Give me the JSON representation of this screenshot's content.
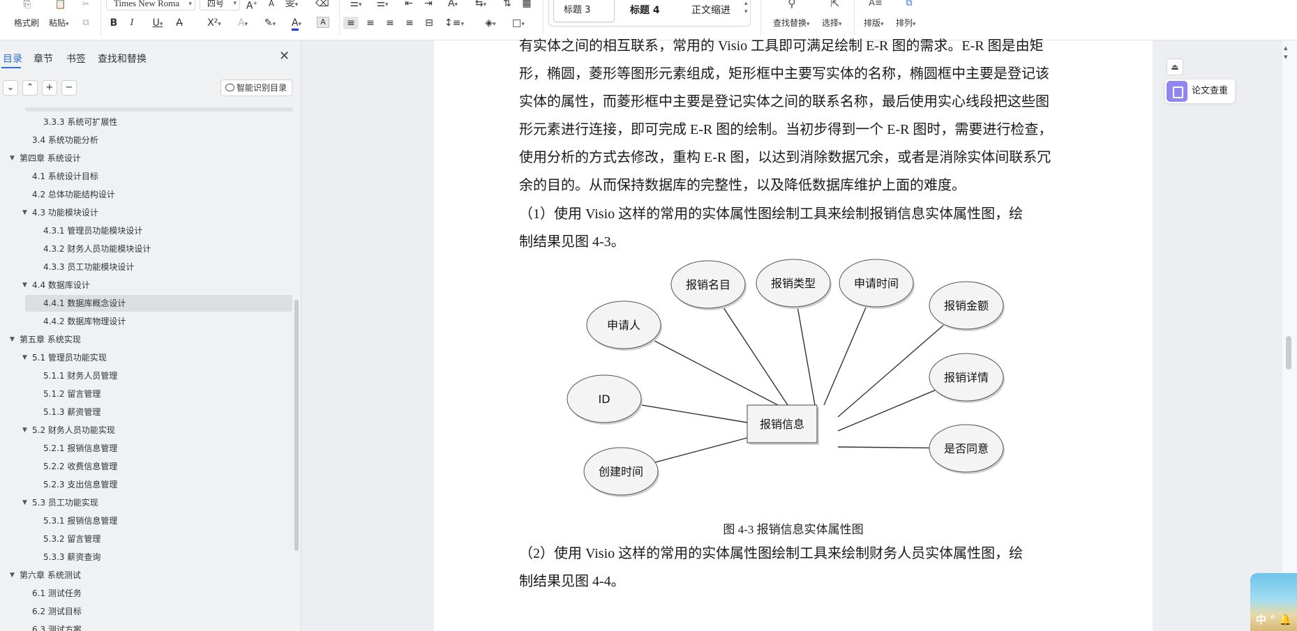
{
  "ribbon": {
    "format_painter_label": "格式刷",
    "paste_label": "粘贴",
    "font_name": "Times New Roma",
    "font_size": "四号",
    "styles": [
      "标题 3",
      "标题 4",
      "正文缩进"
    ],
    "find_replace_label": "查找替换",
    "select_label": "选择",
    "typeset_label": "排版",
    "arrange_label": "排列",
    "font_color": "#1c3fd1"
  },
  "nav": {
    "tabs": [
      "目录",
      "章节",
      "书签",
      "查找和替换"
    ],
    "smart_toc_label": "智能识别目录",
    "toc": [
      {
        "text": "3.3.3 系统可扩展性",
        "level": 3,
        "arrow": ""
      },
      {
        "text": "3.4 系统功能分析",
        "level": 2,
        "arrow": ""
      },
      {
        "text": "第四章  系统设计",
        "level": 1,
        "arrow": "▼"
      },
      {
        "text": "4.1  系统设计目标",
        "level": 2,
        "arrow": ""
      },
      {
        "text": "4.2  总体功能结构设计",
        "level": 2,
        "arrow": ""
      },
      {
        "text": "4.3  功能模块设计",
        "level": 2,
        "arrow": "▼"
      },
      {
        "text": "4.3.1  管理员功能模块设计",
        "level": 3,
        "arrow": ""
      },
      {
        "text": "4.3.2  财务人员功能模块设计",
        "level": 3,
        "arrow": ""
      },
      {
        "text": "4.3.3  员工功能模块设计",
        "level": 3,
        "arrow": ""
      },
      {
        "text": "4.4  数据库设计",
        "level": 2,
        "arrow": "▼"
      },
      {
        "text": "4.4.1  数据库概念设计",
        "level": 3,
        "arrow": "",
        "selected": true
      },
      {
        "text": "4.4.2  数据库物理设计",
        "level": 3,
        "arrow": ""
      },
      {
        "text": "第五章  系统实现",
        "level": 1,
        "arrow": "▼"
      },
      {
        "text": "5.1 管理员功能实现",
        "level": 2,
        "arrow": "▼"
      },
      {
        "text": "5.1.1  财务人员管理",
        "level": 3,
        "arrow": ""
      },
      {
        "text": "5.1.2  留言管理",
        "level": 3,
        "arrow": ""
      },
      {
        "text": "5.1.3  薪资管理",
        "level": 3,
        "arrow": ""
      },
      {
        "text": "5.2  财务人员功能实现",
        "level": 2,
        "arrow": "▼"
      },
      {
        "text": "5.2.1  报销信息管理",
        "level": 3,
        "arrow": ""
      },
      {
        "text": "5.2.2  收费信息管理",
        "level": 3,
        "arrow": ""
      },
      {
        "text": "5.2.3  支出信息管理",
        "level": 3,
        "arrow": ""
      },
      {
        "text": "5.3  员工功能实现",
        "level": 2,
        "arrow": "▼"
      },
      {
        "text": "5.3.1  报销信息管理",
        "level": 3,
        "arrow": ""
      },
      {
        "text": "5.3.2  留言管理",
        "level": 3,
        "arrow": ""
      },
      {
        "text": "5.3.3  薪资查询",
        "level": 3,
        "arrow": ""
      },
      {
        "text": "第六章  系统测试",
        "level": 1,
        "arrow": "▼"
      },
      {
        "text": "6.1  测试任务",
        "level": 2,
        "arrow": ""
      },
      {
        "text": "6.2  测试目标",
        "level": 2,
        "arrow": ""
      },
      {
        "text": "6.3  测试方案",
        "level": 2,
        "arrow": ""
      }
    ]
  },
  "document": {
    "paragraph_lines": [
      "有实体之间的相互联系，常用的 Visio 工具即可满足绘制 E-R 图的需求。E-R 图是由矩",
      "形，椭圆，菱形等图形元素组成，矩形框中主要写实体的名称，椭圆框中主要是登记该",
      "实体的属性，而菱形框中主要是登记实体之间的联系名称，最后使用实心线段把这些图",
      "形元素进行连接，即可完成 E-R 图的绘制。当初步得到一个 E-R 图时，需要进行检查，",
      "使用分析的方式去修改，重构 E-R 图，以达到消除数据冗余，或者是消除实体间联系冗",
      "余的目的。从而保持数据库的完整性，以及降低数据库维护上面的难度。"
    ],
    "para2_lines": [
      "（1）使用 Visio 这样的常用的实体属性图绘制工具来绘制报销信息实体属性图，绘",
      "制结果见图 4-3。"
    ],
    "figure": {
      "entity": "报销信息",
      "attributes": [
        "报销名目",
        "报销类型",
        "申请时间",
        "申请人",
        "报销金额",
        "ID",
        "报销详情",
        "是否同意",
        "创建时间"
      ],
      "caption": "图 4-3  报销信息实体属性图"
    },
    "para3_lines": [
      "（2）使用 Visio 这样的常用的实体属性图绘制工具来绘制财务人员实体属性图，绘",
      "制结果见图 4-4。"
    ]
  },
  "right_rail": {
    "plagiarism_label": "论文查重",
    "corner_text": "中 ° 🔔"
  }
}
